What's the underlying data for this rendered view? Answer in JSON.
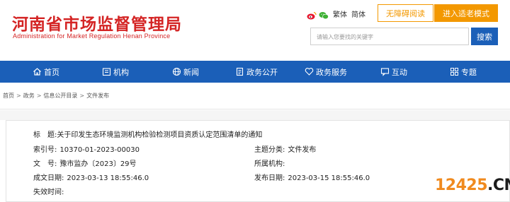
{
  "header": {
    "title": "河南省市场监督管理局",
    "subtitle": "Administration for Market Regulation Henan Province",
    "lang_traditional": "繁体",
    "lang_simplified": "简体",
    "btn_accessible": "无障碍阅读",
    "btn_elder": "进入适老模式",
    "search_placeholder": "请输入您要找的关键字",
    "search_button": "搜索",
    "icons": [
      "weibo-icon",
      "wechat-icon"
    ]
  },
  "nav": {
    "items": [
      {
        "label": "首页",
        "icon": "home-icon"
      },
      {
        "label": "机构",
        "icon": "building-icon"
      },
      {
        "label": "新闻",
        "icon": "globe-icon"
      },
      {
        "label": "政务公开",
        "icon": "document-icon"
      },
      {
        "label": "政务服务",
        "icon": "heart-icon"
      },
      {
        "label": "互动",
        "icon": "chat-icon"
      },
      {
        "label": "专题",
        "icon": "grid-icon"
      }
    ]
  },
  "breadcrumb": [
    "首页",
    "政务",
    "信息公开目录",
    "文件发布"
  ],
  "info": {
    "title_label": "标　题:",
    "title_value": "关于印发生态环境监测机构检验检测项目资质认定范围清单的通知",
    "index_label": "索引号:",
    "index_value": "10370-01-2023-00030",
    "topic_label": "主题分类:",
    "topic_value": "文件发布",
    "docno_label": "文　号:",
    "docno_value": "豫市监办〔2023〕29号",
    "org_label": "所属机构:",
    "org_value": "",
    "created_label": "成文日期:",
    "created_value": "2023-03-13 18:55:46.0",
    "published_label": "发布日期:",
    "published_value": "2023-03-15 18:55:46.0",
    "expire_label": "失效时间:",
    "expire_value": ""
  },
  "watermark": {
    "part1": "12425",
    "part2": ".CN"
  },
  "colors": {
    "brand_red": "#d42424",
    "nav_blue": "#1b5fb8",
    "accent_orange": "#f39800"
  }
}
